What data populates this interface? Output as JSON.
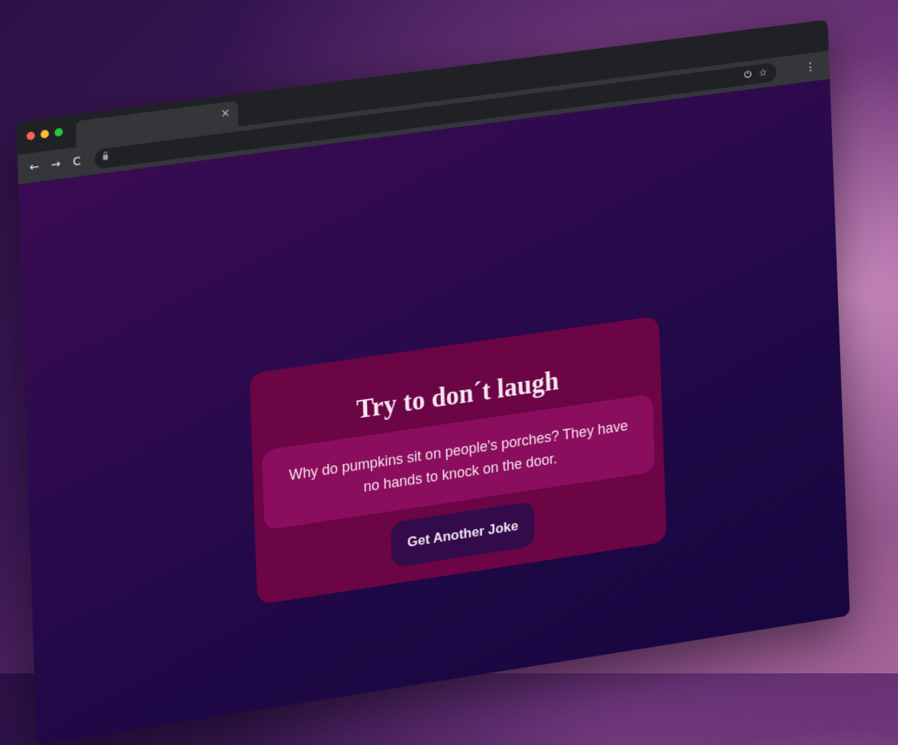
{
  "browser": {
    "tab_close_glyph": "×",
    "back_glyph": "←",
    "forward_glyph": "→",
    "reload_glyph": "C",
    "share_glyph": "⏻",
    "star_glyph": "☆",
    "menu_glyph": "⋮"
  },
  "page": {
    "title": "Try to don´t laugh",
    "joke": "Why do pumpkins sit on people's porches? They have no hands to knock on the door.",
    "button_label": "Get Another Joke"
  },
  "colors": {
    "card": "#6b0545",
    "joke_box": "#8b0e5e",
    "button": "#330b4a",
    "page_bg": "#2a0a4c"
  }
}
